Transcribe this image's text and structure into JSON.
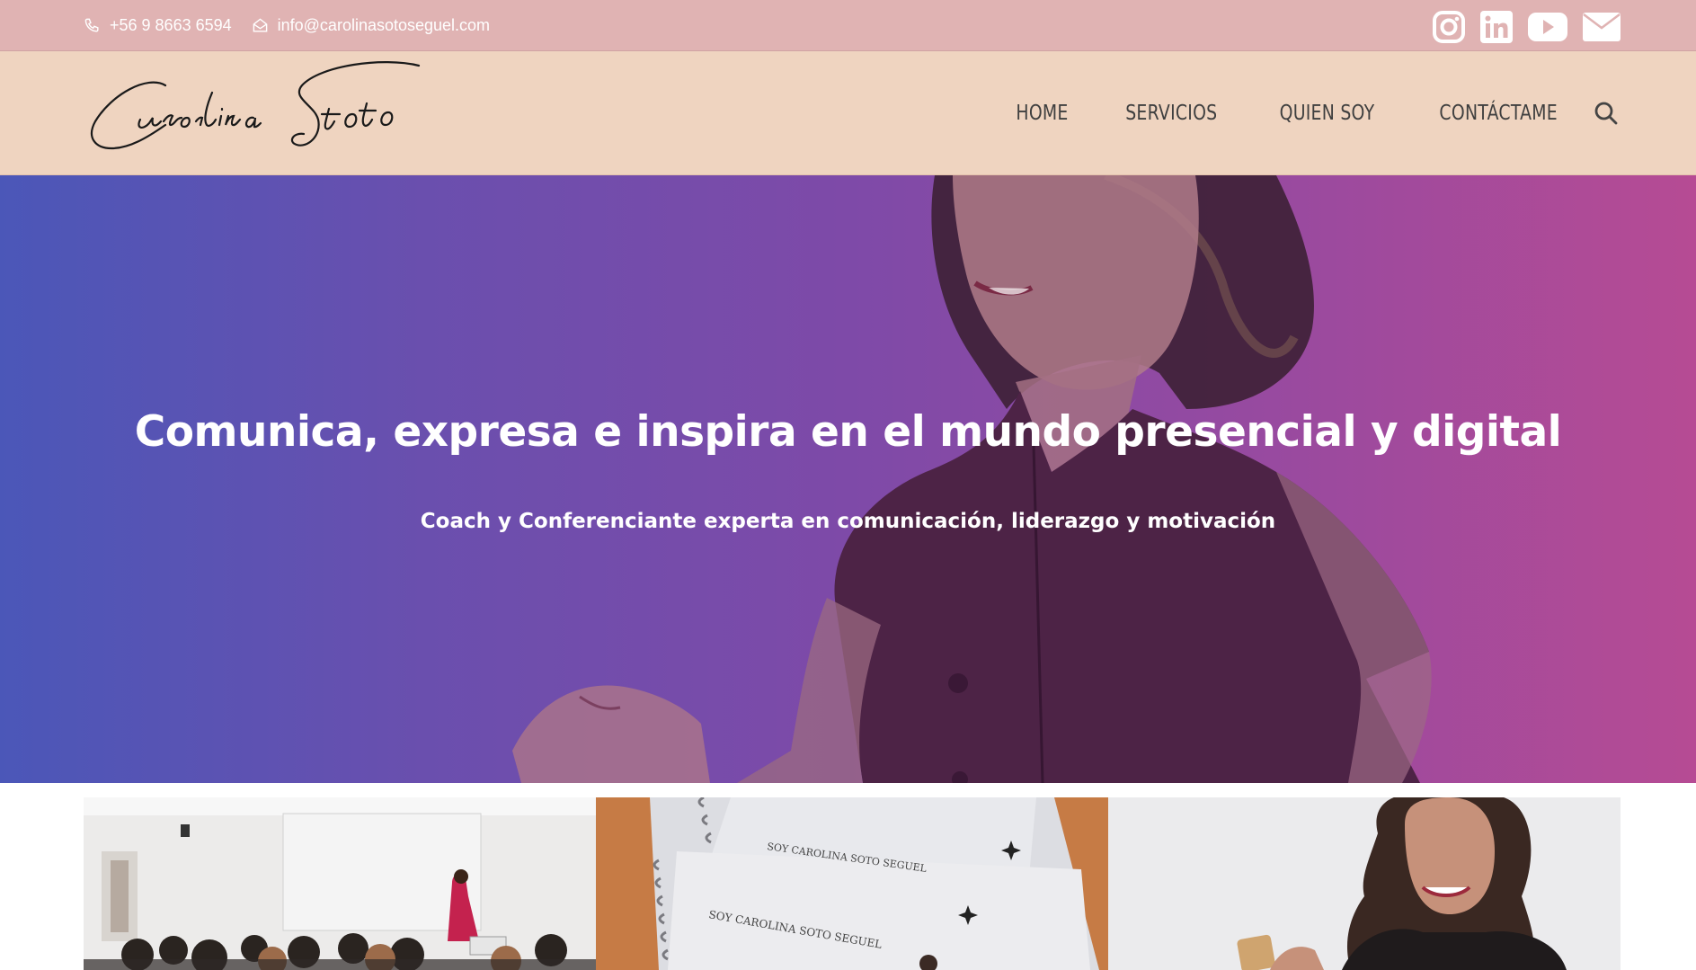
{
  "topbar": {
    "phone": "+56 9 8663 6594",
    "email": "info@carolinasotoseguel.com",
    "phone_icon": "phone-icon",
    "email_icon": "envelope-open-icon",
    "social": [
      "instagram-icon",
      "linkedin-icon",
      "youtube-icon",
      "mail-icon"
    ]
  },
  "header": {
    "logo_text": "Carolina Soto",
    "nav": [
      {
        "label": "HOME"
      },
      {
        "label": "SERVICIOS"
      },
      {
        "label": "QUIEN SOY"
      },
      {
        "label": "CONTÁCTAME"
      }
    ],
    "search_icon": "search-icon"
  },
  "hero": {
    "title": "Comunica, expresa e inspira en el mundo presencial y digital",
    "subtitle": "Coach y Conferenciante experta en comunicación, liderazgo y motivación"
  },
  "cards": [
    {
      "name": "conference-photo"
    },
    {
      "name": "notebook-photo",
      "text1": "SOY CAROLINA SOTO SEGUEL",
      "text2": "SOY CAROLINA SOTO SEGUEL"
    },
    {
      "name": "portrait-photo"
    }
  ],
  "colors": {
    "topbar_bg": "#e0b3b3",
    "header_bg": "#efd4c0",
    "hero_left": "#4b57b8",
    "hero_right": "#b64b94"
  }
}
